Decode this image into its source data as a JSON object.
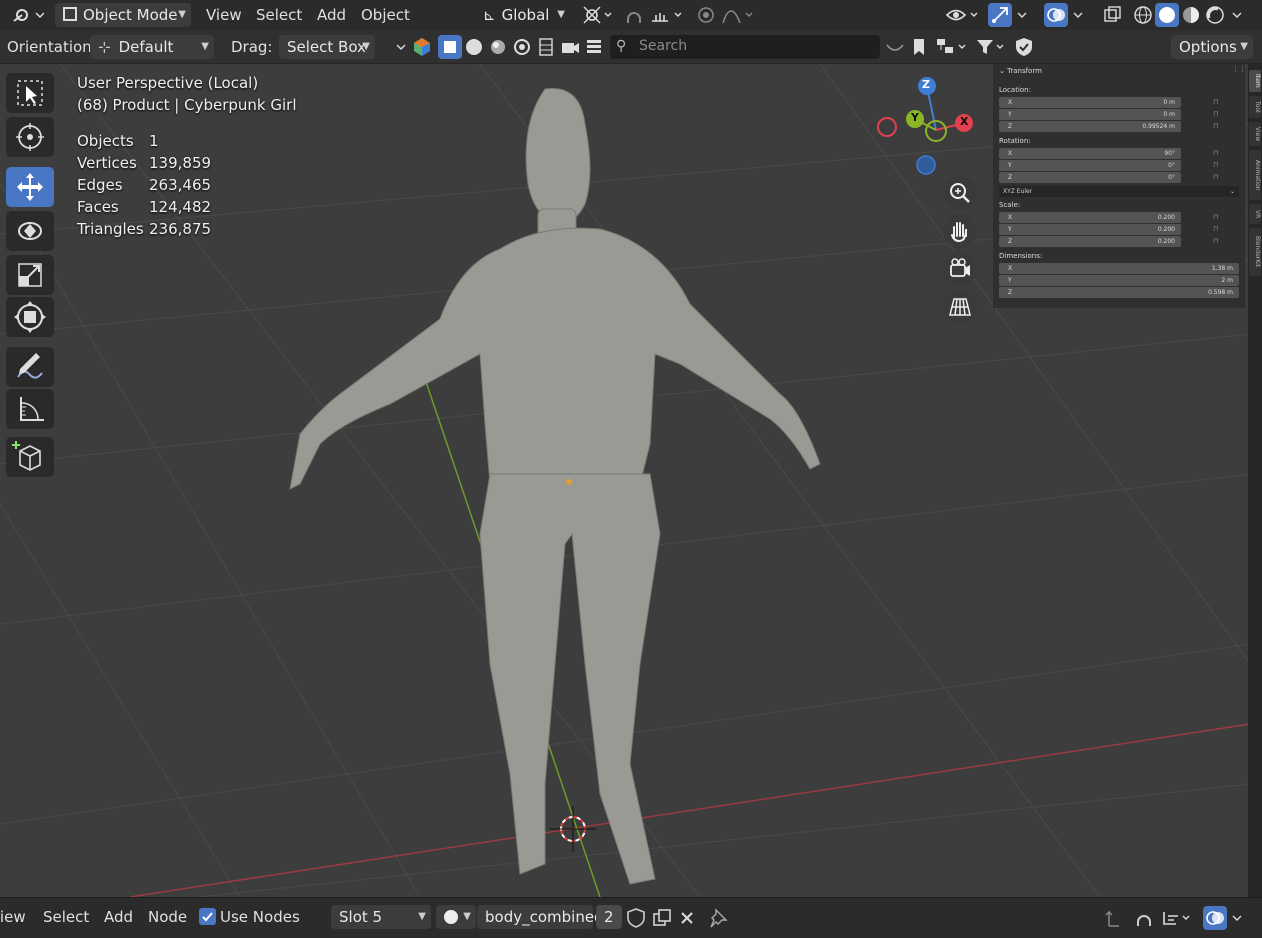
{
  "header": {
    "mode_label": "Object Mode",
    "menus": [
      "View",
      "Select",
      "Add",
      "Object"
    ],
    "transform_orientation": "Global"
  },
  "tool_settings": {
    "orientation_label": "Orientation:",
    "orientation_value": "Default",
    "drag_label": "Drag:",
    "drag_value": "Select Box",
    "search_placeholder": "Search",
    "options_label": "Options"
  },
  "viewport": {
    "perspective": "User Perspective (Local)",
    "object_info": "(68) Product | Cyberpunk Girl",
    "stats": [
      {
        "label": "Objects",
        "value": "1"
      },
      {
        "label": "Vertices",
        "value": "139,859"
      },
      {
        "label": "Edges",
        "value": "263,465"
      },
      {
        "label": "Faces",
        "value": "124,482"
      },
      {
        "label": "Triangles",
        "value": "236,875"
      }
    ],
    "gizmo": {
      "x": "X",
      "y": "Y",
      "z": "Z"
    }
  },
  "transform_panel": {
    "title": "Transform",
    "location_label": "Location:",
    "location": [
      {
        "k": "X",
        "v": "0 m"
      },
      {
        "k": "Y",
        "v": "0 m"
      },
      {
        "k": "Z",
        "v": "0.99524 m"
      }
    ],
    "rotation_label": "Rotation:",
    "rotation": [
      {
        "k": "X",
        "v": "90°"
      },
      {
        "k": "Y",
        "v": "0°"
      },
      {
        "k": "Z",
        "v": "0°"
      }
    ],
    "rotation_mode": "XYZ Euler",
    "scale_label": "Scale:",
    "scale": [
      {
        "k": "X",
        "v": "0.200"
      },
      {
        "k": "Y",
        "v": "0.200"
      },
      {
        "k": "Z",
        "v": "0.200"
      }
    ],
    "dimensions_label": "Dimensions:",
    "dimensions": [
      {
        "k": "X",
        "v": "1.38 m"
      },
      {
        "k": "Y",
        "v": "2 m"
      },
      {
        "k": "Z",
        "v": "0.598 m"
      }
    ]
  },
  "side_tabs": [
    "Item",
    "Tool",
    "View",
    "Animation",
    "VR",
    "BlenderKit"
  ],
  "footer": {
    "menus": [
      "View",
      "Select",
      "Add",
      "Node"
    ],
    "use_nodes_label": "Use Nodes",
    "slot_label": "Slot 5",
    "material_name": "body_combined",
    "user_count": "2"
  },
  "colors": {
    "accent": "#4a77c4",
    "axis_x": "#e0404f",
    "axis_y": "#8ab626",
    "axis_z": "#3d7fd7"
  }
}
